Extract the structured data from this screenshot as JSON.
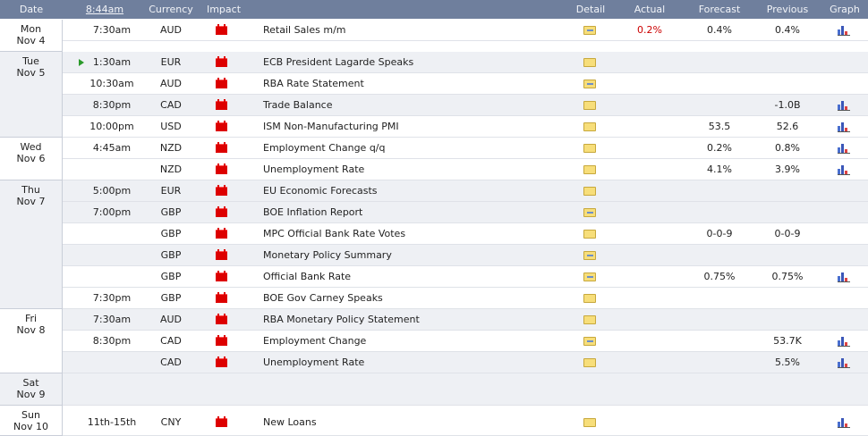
{
  "header": {
    "date": "Date",
    "time": "8:44am",
    "currency": "Currency",
    "impact": "Impact",
    "detail": "Detail",
    "actual": "Actual",
    "forecast": "Forecast",
    "previous": "Previous",
    "graph": "Graph"
  },
  "days": [
    {
      "dow": "Mon",
      "date": "Nov 4"
    },
    {
      "dow": "Tue",
      "date": "Nov 5"
    },
    {
      "dow": "Wed",
      "date": "Nov 6"
    },
    {
      "dow": "Thu",
      "date": "Nov 7"
    },
    {
      "dow": "Fri",
      "date": "Nov 8"
    },
    {
      "dow": "Sat",
      "date": "Nov 9"
    },
    {
      "dow": "Sun",
      "date": "Nov 10"
    }
  ],
  "events": [
    {
      "time": "7:30am",
      "currency": "AUD",
      "event": "Retail Sales m/m",
      "actual": "0.2%",
      "forecast": "0.4%",
      "previous": "0.4%"
    },
    {
      "time": "1:30am",
      "currency": "EUR",
      "event": "ECB President Lagarde Speaks",
      "actual": "",
      "forecast": "",
      "previous": ""
    },
    {
      "time": "10:30am",
      "currency": "AUD",
      "event": "RBA Rate Statement",
      "actual": "",
      "forecast": "",
      "previous": ""
    },
    {
      "time": "8:30pm",
      "currency": "CAD",
      "event": "Trade Balance",
      "actual": "",
      "forecast": "",
      "previous": "-1.0B"
    },
    {
      "time": "10:00pm",
      "currency": "USD",
      "event": "ISM Non-Manufacturing PMI",
      "actual": "",
      "forecast": "53.5",
      "previous": "52.6"
    },
    {
      "time": "4:45am",
      "currency": "NZD",
      "event": "Employment Change q/q",
      "actual": "",
      "forecast": "0.2%",
      "previous": "0.8%"
    },
    {
      "time": "",
      "currency": "NZD",
      "event": "Unemployment Rate",
      "actual": "",
      "forecast": "4.1%",
      "previous": "3.9%"
    },
    {
      "time": "5:00pm",
      "currency": "EUR",
      "event": "EU Economic Forecasts",
      "actual": "",
      "forecast": "",
      "previous": ""
    },
    {
      "time": "7:00pm",
      "currency": "GBP",
      "event": "BOE Inflation Report",
      "actual": "",
      "forecast": "",
      "previous": ""
    },
    {
      "time": "",
      "currency": "GBP",
      "event": "MPC Official Bank Rate Votes",
      "actual": "",
      "forecast": "0-0-9",
      "previous": "0-0-9"
    },
    {
      "time": "",
      "currency": "GBP",
      "event": "Monetary Policy Summary",
      "actual": "",
      "forecast": "",
      "previous": ""
    },
    {
      "time": "",
      "currency": "GBP",
      "event": "Official Bank Rate",
      "actual": "",
      "forecast": "0.75%",
      "previous": "0.75%"
    },
    {
      "time": "7:30pm",
      "currency": "GBP",
      "event": "BOE Gov Carney Speaks",
      "actual": "",
      "forecast": "",
      "previous": ""
    },
    {
      "time": "7:30am",
      "currency": "AUD",
      "event": "RBA Monetary Policy Statement",
      "actual": "",
      "forecast": "",
      "previous": ""
    },
    {
      "time": "8:30pm",
      "currency": "CAD",
      "event": "Employment Change",
      "actual": "",
      "forecast": "",
      "previous": "53.7K"
    },
    {
      "time": "",
      "currency": "CAD",
      "event": "Unemployment Rate",
      "actual": "",
      "forecast": "",
      "previous": "5.5%"
    },
    {
      "time": "11th-15th",
      "currency": "CNY",
      "event": "New Loans",
      "actual": "",
      "forecast": "",
      "previous": ""
    }
  ],
  "icons": {
    "impact": "high-impact-folder-icon",
    "detail": "detail-folder-icon",
    "graph": "bar-graph-icon",
    "next_event": "play-icon"
  },
  "colors": {
    "header_bg": "#6f7f9d",
    "actual_text": "#cc0000",
    "impact_high": "#dd0000"
  }
}
